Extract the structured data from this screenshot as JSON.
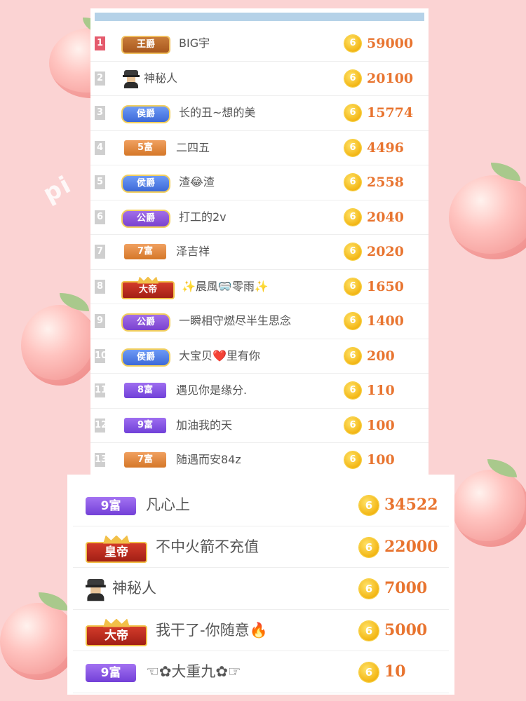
{
  "panel1": {
    "rows": [
      {
        "rank": "1",
        "badge": "王爵",
        "name": "BIG宇",
        "score": "59000"
      },
      {
        "rank": "2",
        "badge": "",
        "name": "神秘人",
        "score": "20100"
      },
      {
        "rank": "3",
        "badge": "侯爵",
        "name": "长的丑~想的美",
        "score": "15774"
      },
      {
        "rank": "4",
        "badge": "5富",
        "name": "二四五",
        "score": "4496"
      },
      {
        "rank": "5",
        "badge": "侯爵",
        "name": "渣😂渣",
        "score": "2558"
      },
      {
        "rank": "6",
        "badge": "公爵",
        "name": "打工的2v",
        "score": "2040"
      },
      {
        "rank": "7",
        "badge": "7富",
        "name": "泽吉祥",
        "score": "2020"
      },
      {
        "rank": "8",
        "badge": "大帝",
        "name": "✨晨風🥽零雨✨",
        "score": "1650"
      },
      {
        "rank": "9",
        "badge": "公爵",
        "name": "一瞬相守燃尽半生思念",
        "score": "1400"
      },
      {
        "rank": "10",
        "badge": "侯爵",
        "name": "大宝贝❤️里有你",
        "score": "200"
      },
      {
        "rank": "11",
        "badge": "8富",
        "name": "遇见你是缘分.",
        "score": "110"
      },
      {
        "rank": "12",
        "badge": "9富",
        "name": "加油我的天",
        "score": "100"
      },
      {
        "rank": "13",
        "badge": "7富",
        "name": "随遇而安84z",
        "score": "100"
      }
    ]
  },
  "panel2": {
    "rows": [
      {
        "badge": "9富",
        "name": "凡心上",
        "score": "34522"
      },
      {
        "badge": "皇帝",
        "name": "不中火箭不充值",
        "score": "22000"
      },
      {
        "badge": "",
        "name": "神秘人",
        "score": "7000"
      },
      {
        "badge": "大帝",
        "name": "我干了-你随意🔥",
        "score": "5000"
      },
      {
        "badge": "9富",
        "name": "☜✿大重九✿☞",
        "score": "10"
      }
    ]
  },
  "coin_glyph": "6",
  "watermark": "pi",
  "colors": {
    "score": "#e8742f",
    "background": "#fbd3d3",
    "topbar": "#b5d2e8"
  }
}
